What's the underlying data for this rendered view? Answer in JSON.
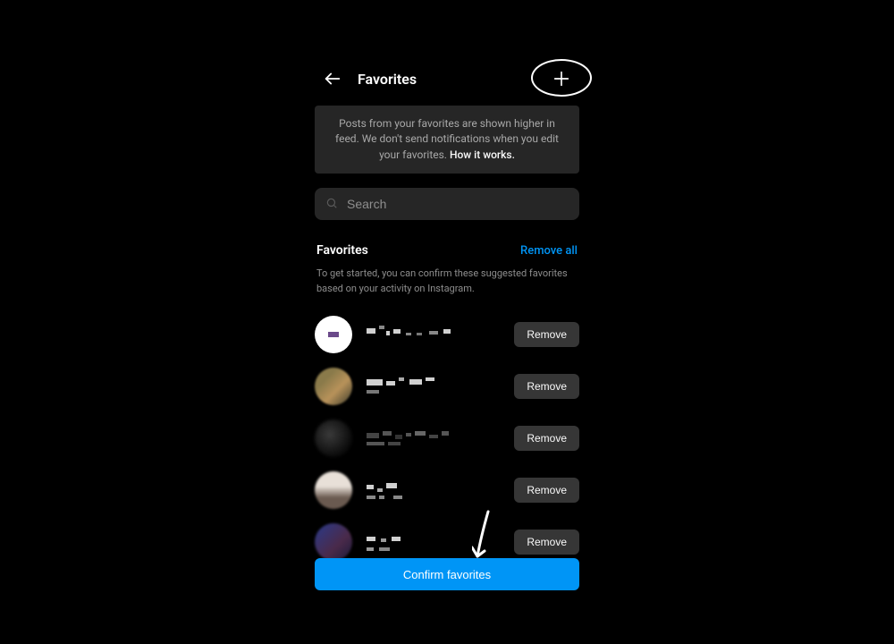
{
  "header": {
    "title": "Favorites"
  },
  "info": {
    "text_a": "Posts from your favorites are shown higher in feed. We don't send notifications when you edit your favorites. ",
    "link": "How it works."
  },
  "search": {
    "placeholder": "Search"
  },
  "section": {
    "title": "Favorites",
    "remove_all": "Remove all",
    "desc": "To get started, you can confirm these suggested favorites based on your activity on Instagram."
  },
  "rows": [
    {
      "remove": "Remove"
    },
    {
      "remove": "Remove"
    },
    {
      "remove": "Remove"
    },
    {
      "remove": "Remove"
    },
    {
      "remove": "Remove"
    }
  ],
  "confirm": {
    "label": "Confirm favorites"
  },
  "colors": {
    "accent": "#0095f6",
    "bg": "#000000",
    "panel": "#262626"
  }
}
